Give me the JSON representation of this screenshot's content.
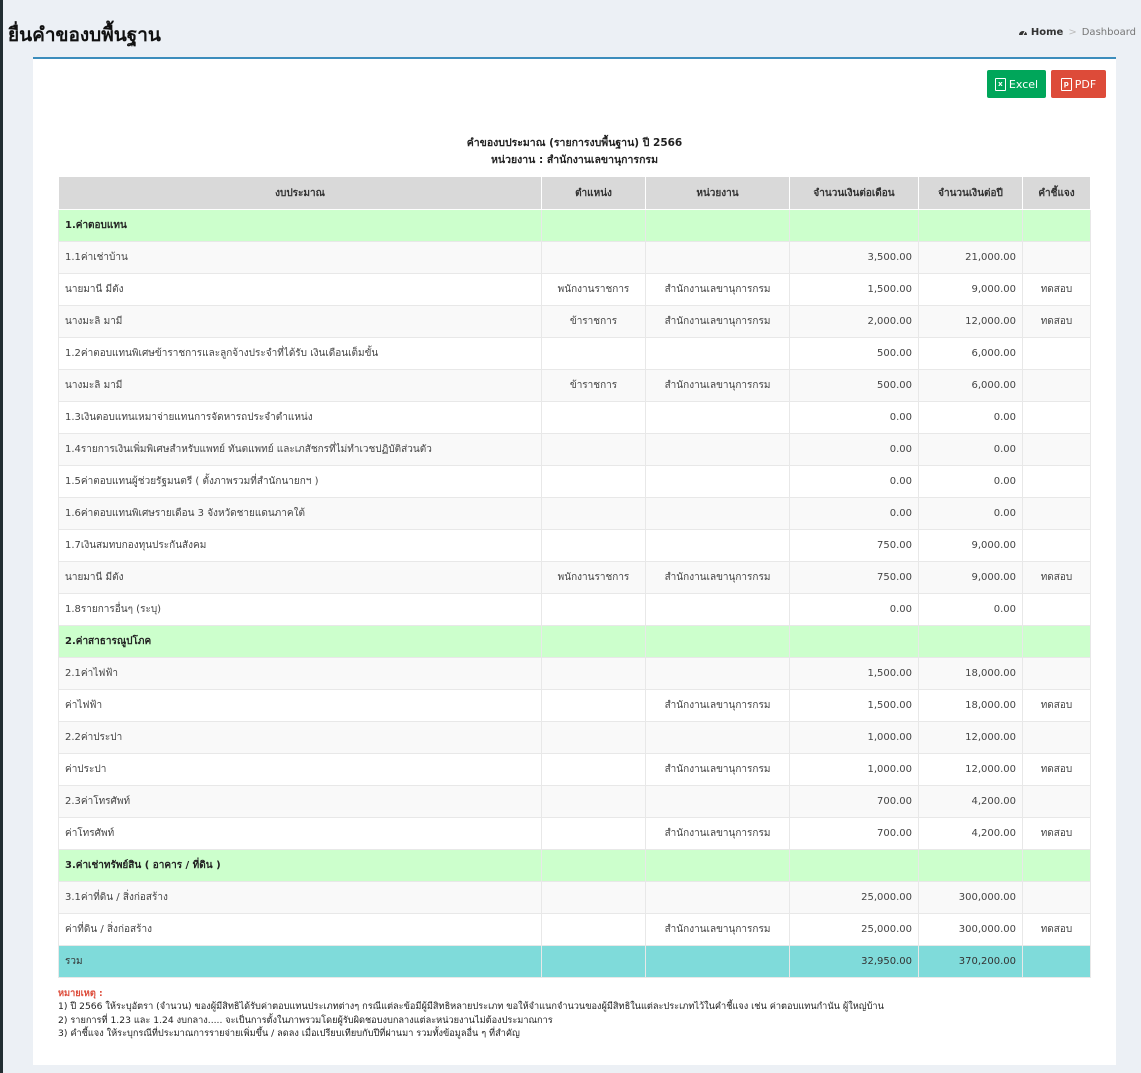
{
  "page": {
    "title": "ยื่นคำของบพื้นฐาน",
    "breadcrumb": {
      "home": "Home",
      "current": "Dashboard"
    }
  },
  "toolbar": {
    "excel_label": "Excel",
    "pdf_label": "PDF"
  },
  "report": {
    "title": "คำของบประมาณ (รายการงบพื้นฐาน) ปี 2566",
    "subtitle": "หน่วยงาน : สำนักงานเลขานุการกรม"
  },
  "table": {
    "headers": [
      "งบประมาณ",
      "ตำแหน่ง",
      "หน่วยงาน",
      "จำนวนเงินต่อเดือน",
      "จำนวนเงินต่อปี",
      "คำชี้แจง"
    ],
    "rows": [
      {
        "kind": "cat",
        "budget": "1.ค่าตอบแทน",
        "position": "",
        "unit": "",
        "monthly": "",
        "yearly": "",
        "note": ""
      },
      {
        "kind": "item",
        "budget": "1.1ค่าเช่าบ้าน",
        "position": "",
        "unit": "",
        "monthly": "3,500.00",
        "yearly": "21,000.00",
        "note": ""
      },
      {
        "kind": "item",
        "budget": "นายมานี มีตัง",
        "position": "พนักงานราชการ",
        "unit": "สำนักงานเลขานุการกรม",
        "monthly": "1,500.00",
        "yearly": "9,000.00",
        "note": "ทดสอบ"
      },
      {
        "kind": "item",
        "budget": "นางมะลิ มามี",
        "position": "ข้าราชการ",
        "unit": "สำนักงานเลขานุการกรม",
        "monthly": "2,000.00",
        "yearly": "12,000.00",
        "note": "ทดสอบ"
      },
      {
        "kind": "item",
        "budget": "1.2ค่าตอบแทนพิเศษข้าราชการและลูกจ้างประจำที่ได้รับ เงินเดือนเต็มขั้น",
        "position": "",
        "unit": "",
        "monthly": "500.00",
        "yearly": "6,000.00",
        "note": ""
      },
      {
        "kind": "item",
        "budget": "นางมะลิ มามี",
        "position": "ข้าราชการ",
        "unit": "สำนักงานเลขานุการกรม",
        "monthly": "500.00",
        "yearly": "6,000.00",
        "note": ""
      },
      {
        "kind": "item",
        "budget": "1.3เงินตอบแทนเหมาจ่ายแทนการจัดหารถประจำตำแหน่ง",
        "position": "",
        "unit": "",
        "monthly": "0.00",
        "yearly": "0.00",
        "note": ""
      },
      {
        "kind": "item",
        "budget": "1.4รายการเงินเพิ่มพิเศษสำหรับแพทย์ ทันตแพทย์ และเภสัชกรที่ไม่ทำเวชปฏิบัติส่วนตัว",
        "position": "",
        "unit": "",
        "monthly": "0.00",
        "yearly": "0.00",
        "note": ""
      },
      {
        "kind": "item",
        "budget": "1.5ค่าตอบแทนผู้ช่วยรัฐมนตรี ( ตั้งภาพรวมที่สำนักนายกฯ )",
        "position": "",
        "unit": "",
        "monthly": "0.00",
        "yearly": "0.00",
        "note": ""
      },
      {
        "kind": "item",
        "budget": "1.6ค่าตอบแทนพิเศษรายเดือน 3 จังหวัดชายแดนภาคใต้",
        "position": "",
        "unit": "",
        "monthly": "0.00",
        "yearly": "0.00",
        "note": ""
      },
      {
        "kind": "item",
        "budget": "1.7เงินสมทบกองทุนประกันสังคม",
        "position": "",
        "unit": "",
        "monthly": "750.00",
        "yearly": "9,000.00",
        "note": ""
      },
      {
        "kind": "item",
        "budget": "นายมานี มีตัง",
        "position": "พนักงานราชการ",
        "unit": "สำนักงานเลขานุการกรม",
        "monthly": "750.00",
        "yearly": "9,000.00",
        "note": "ทดสอบ"
      },
      {
        "kind": "item",
        "budget": "1.8รายการอื่นๆ (ระบุ)",
        "position": "",
        "unit": "",
        "monthly": "0.00",
        "yearly": "0.00",
        "note": ""
      },
      {
        "kind": "cat",
        "budget": "2.ค่าสาธารณูปโภค",
        "position": "",
        "unit": "",
        "monthly": "",
        "yearly": "",
        "note": ""
      },
      {
        "kind": "item",
        "budget": "2.1ค่าไฟฟ้า",
        "position": "",
        "unit": "",
        "monthly": "1,500.00",
        "yearly": "18,000.00",
        "note": ""
      },
      {
        "kind": "item",
        "budget": "ค่าไฟฟ้า",
        "position": "",
        "unit": "สำนักงานเลขานุการกรม",
        "monthly": "1,500.00",
        "yearly": "18,000.00",
        "note": "ทดสอบ"
      },
      {
        "kind": "item",
        "budget": "2.2ค่าประปา",
        "position": "",
        "unit": "",
        "monthly": "1,000.00",
        "yearly": "12,000.00",
        "note": ""
      },
      {
        "kind": "item",
        "budget": "ค่าประปา",
        "position": "",
        "unit": "สำนักงานเลขานุการกรม",
        "monthly": "1,000.00",
        "yearly": "12,000.00",
        "note": "ทดสอบ"
      },
      {
        "kind": "item",
        "budget": "2.3ค่าโทรศัพท์",
        "position": "",
        "unit": "",
        "monthly": "700.00",
        "yearly": "4,200.00",
        "note": ""
      },
      {
        "kind": "item",
        "budget": "ค่าโทรศัพท์",
        "position": "",
        "unit": "สำนักงานเลขานุการกรม",
        "monthly": "700.00",
        "yearly": "4,200.00",
        "note": "ทดสอบ"
      },
      {
        "kind": "cat",
        "budget": "3.ค่าเช่าทรัพย์สิน ( อาคาร / ที่ดิน )",
        "position": "",
        "unit": "",
        "monthly": "",
        "yearly": "",
        "note": ""
      },
      {
        "kind": "item",
        "budget": "3.1ค่าที่ดิน / สิ่งก่อสร้าง",
        "position": "",
        "unit": "",
        "monthly": "25,000.00",
        "yearly": "300,000.00",
        "note": ""
      },
      {
        "kind": "item",
        "budget": "ค่าที่ดิน / สิ่งก่อสร้าง",
        "position": "",
        "unit": "สำนักงานเลขานุการกรม",
        "monthly": "25,000.00",
        "yearly": "300,000.00",
        "note": "ทดสอบ"
      },
      {
        "kind": "total",
        "budget": "รวม",
        "position": "",
        "unit": "",
        "monthly": "32,950.00",
        "yearly": "370,200.00",
        "note": ""
      }
    ]
  },
  "notes": {
    "title": "หมายเหตุ :",
    "items": [
      "1) ปี 2566 ให้ระบุอัตรา (จำนวน) ของผู้มีสิทธิได้รับค่าตอบแทนประเภทต่างๆ กรณีแต่ละข้อมีผู้มีสิทธิหลายประเภท ขอให้จำแนกจำนวนของผู้มีสิทธิในแต่ละประเภทไว้ในคำชี้แจง เช่น ค่าตอบแทนกำนัน ผู้ใหญ่บ้าน",
      "2) รายการที่ 1.23 และ 1.24 งบกลาง..... จะเป็นการตั้งในภาพรวมโดยผู้รับผิดชอบงบกลางแต่ละหน่วยงานไม่ต้องประมาณการ",
      "3) คำชี้แจง ให้ระบุกรณีที่ประมาณการรายจ่ายเพิ่มขึ้น / ลดลง เมื่อเปรียบเทียบกับปีที่ผ่านมา รวมทั้งข้อมูลอื่น ๆ ที่สำคัญ"
    ]
  },
  "colors": {
    "category_row": "#ccffcc",
    "total_row": "#7fdbda",
    "header_row": "#d9d9d9",
    "excel_button": "#00a65a",
    "pdf_button": "#dd4b39",
    "box_border": "#3c8dbc"
  },
  "icons": {
    "breadcrumb": "dashboard-icon",
    "excel": "file-excel-icon",
    "pdf": "file-pdf-icon"
  }
}
